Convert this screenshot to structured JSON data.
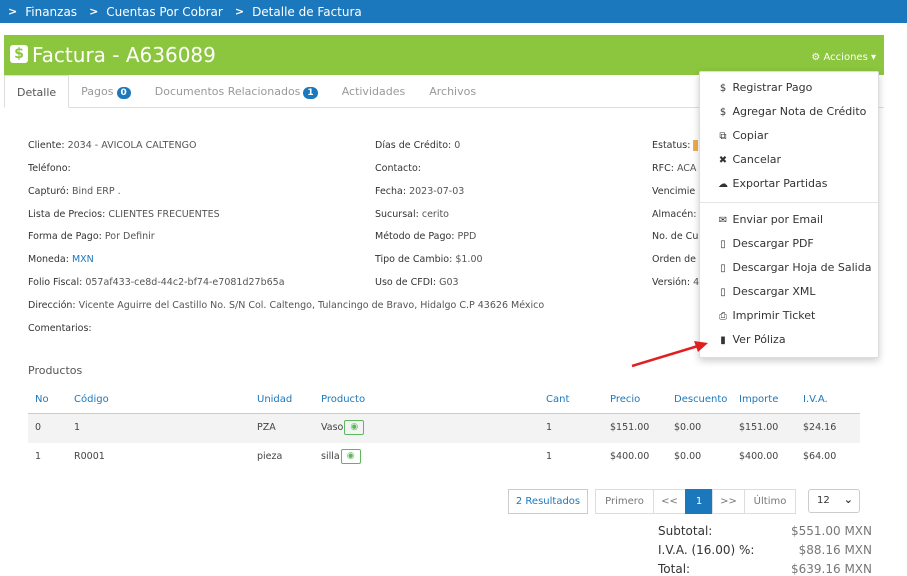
{
  "breadcrumb": {
    "items": [
      "Finanzas",
      "Cuentas Por Cobrar",
      "Detalle de Factura"
    ]
  },
  "header": {
    "title": "Factura - A636089",
    "acciones_label": "Acciones"
  },
  "tabs": [
    {
      "label": "Detalle",
      "badge": ""
    },
    {
      "label": "Pagos",
      "badge": "0"
    },
    {
      "label": "Documentos Relacionados",
      "badge": "1"
    },
    {
      "label": "Actividades",
      "badge": ""
    },
    {
      "label": "Archivos",
      "badge": ""
    }
  ],
  "details": {
    "col1": [
      {
        "label": "Cliente:",
        "value": "2034 - AVICOLA CALTENGO"
      },
      {
        "label": "Teléfono:",
        "value": ""
      },
      {
        "label": "Capturó:",
        "value": "Bind ERP ."
      },
      {
        "label": "Lista de Precios:",
        "value": "CLIENTES FRECUENTES"
      },
      {
        "label": "Forma de Pago:",
        "value": "Por Definir"
      },
      {
        "label": "Moneda:",
        "value": "MXN"
      },
      {
        "label": "Folio Fiscal:",
        "value": "057af433-ce8d-44c2-bf74-e7081d27b65a"
      }
    ],
    "col2": [
      {
        "label": "Días de Crédito:",
        "value": "0"
      },
      {
        "label": "Contacto:",
        "value": ""
      },
      {
        "label": "Fecha:",
        "value": "2023-07-03"
      },
      {
        "label": "Sucursal:",
        "value": "cerito"
      },
      {
        "label": "Método de Pago:",
        "value": "PPD"
      },
      {
        "label": "Tipo de Cambio:",
        "value": "$1.00"
      },
      {
        "label": "Uso de CFDI:",
        "value": "G03"
      }
    ],
    "col3": [
      {
        "label": "Estatus:",
        "value": ""
      },
      {
        "label": "RFC:",
        "value": "ACA"
      },
      {
        "label": "Vencimie",
        "value": ""
      },
      {
        "label": "Almacén:",
        "value": ""
      },
      {
        "label": "No. de Cu",
        "value": ""
      },
      {
        "label": "Orden de",
        "value": ""
      },
      {
        "label": "Versión:",
        "value": "4"
      }
    ],
    "direccion": {
      "label": "Dirección:",
      "value": "Vicente Aguirre del Castillo No. S/N Col. Caltengo, Tulancingo de Bravo, Hidalgo C.P 43626 México"
    },
    "comentarios": {
      "label": "Comentarios:",
      "value": ""
    }
  },
  "productos": {
    "title": "Productos",
    "columns": [
      "No",
      "Código",
      "Unidad",
      "Producto",
      "Cant",
      "Precio",
      "Descuento",
      "Importe",
      "I.V.A."
    ],
    "rows": [
      [
        "0",
        "1",
        "PZA",
        "Vaso",
        "1",
        "$151.00",
        "$0.00",
        "$151.00",
        "$24.16"
      ],
      [
        "1",
        "R0001",
        "pieza",
        "silla",
        "1",
        "$400.00",
        "$0.00",
        "$400.00",
        "$64.00"
      ]
    ]
  },
  "pagination": {
    "results": "2 Resultados",
    "first": "Primero",
    "prev": "<<",
    "current": "1",
    "next": ">>",
    "last": "Último",
    "page_size": "12"
  },
  "totals": [
    {
      "label": "Subtotal:",
      "value": "$551.00 MXN"
    },
    {
      "label": "I.V.A. (16.00) %:",
      "value": "$88.16 MXN"
    },
    {
      "label": "Total:",
      "value": "$639.16 MXN"
    }
  ],
  "menu": {
    "group1": [
      {
        "icon": "dollar-icon",
        "glyph": "$",
        "label": "Registrar Pago"
      },
      {
        "icon": "dollar-icon",
        "glyph": "$",
        "label": "Agregar Nota de Crédito"
      },
      {
        "icon": "copy-icon",
        "glyph": "⧉",
        "label": "Copiar"
      },
      {
        "icon": "times-icon",
        "glyph": "✖",
        "label": "Cancelar"
      },
      {
        "icon": "cloud-download-icon",
        "glyph": "☁",
        "label": "Exportar Partidas"
      }
    ],
    "group2": [
      {
        "icon": "envelope-icon",
        "glyph": "✉",
        "label": "Enviar por Email"
      },
      {
        "icon": "pdf-file-icon",
        "glyph": "▯",
        "label": "Descargar PDF"
      },
      {
        "icon": "file-icon",
        "glyph": "▯",
        "label": "Descargar Hoja de Salida"
      },
      {
        "icon": "file-icon",
        "glyph": "▯",
        "label": "Descargar XML"
      },
      {
        "icon": "print-icon",
        "glyph": "⎙",
        "label": "Imprimir Ticket"
      },
      {
        "icon": "file-solid-icon",
        "glyph": "▮",
        "label": "Ver Póliza"
      }
    ]
  },
  "colors": {
    "primary": "#1b78bd",
    "header_green": "#8cc63f",
    "status_orange": "#f0ad4e",
    "arrow_red": "#e02020"
  }
}
